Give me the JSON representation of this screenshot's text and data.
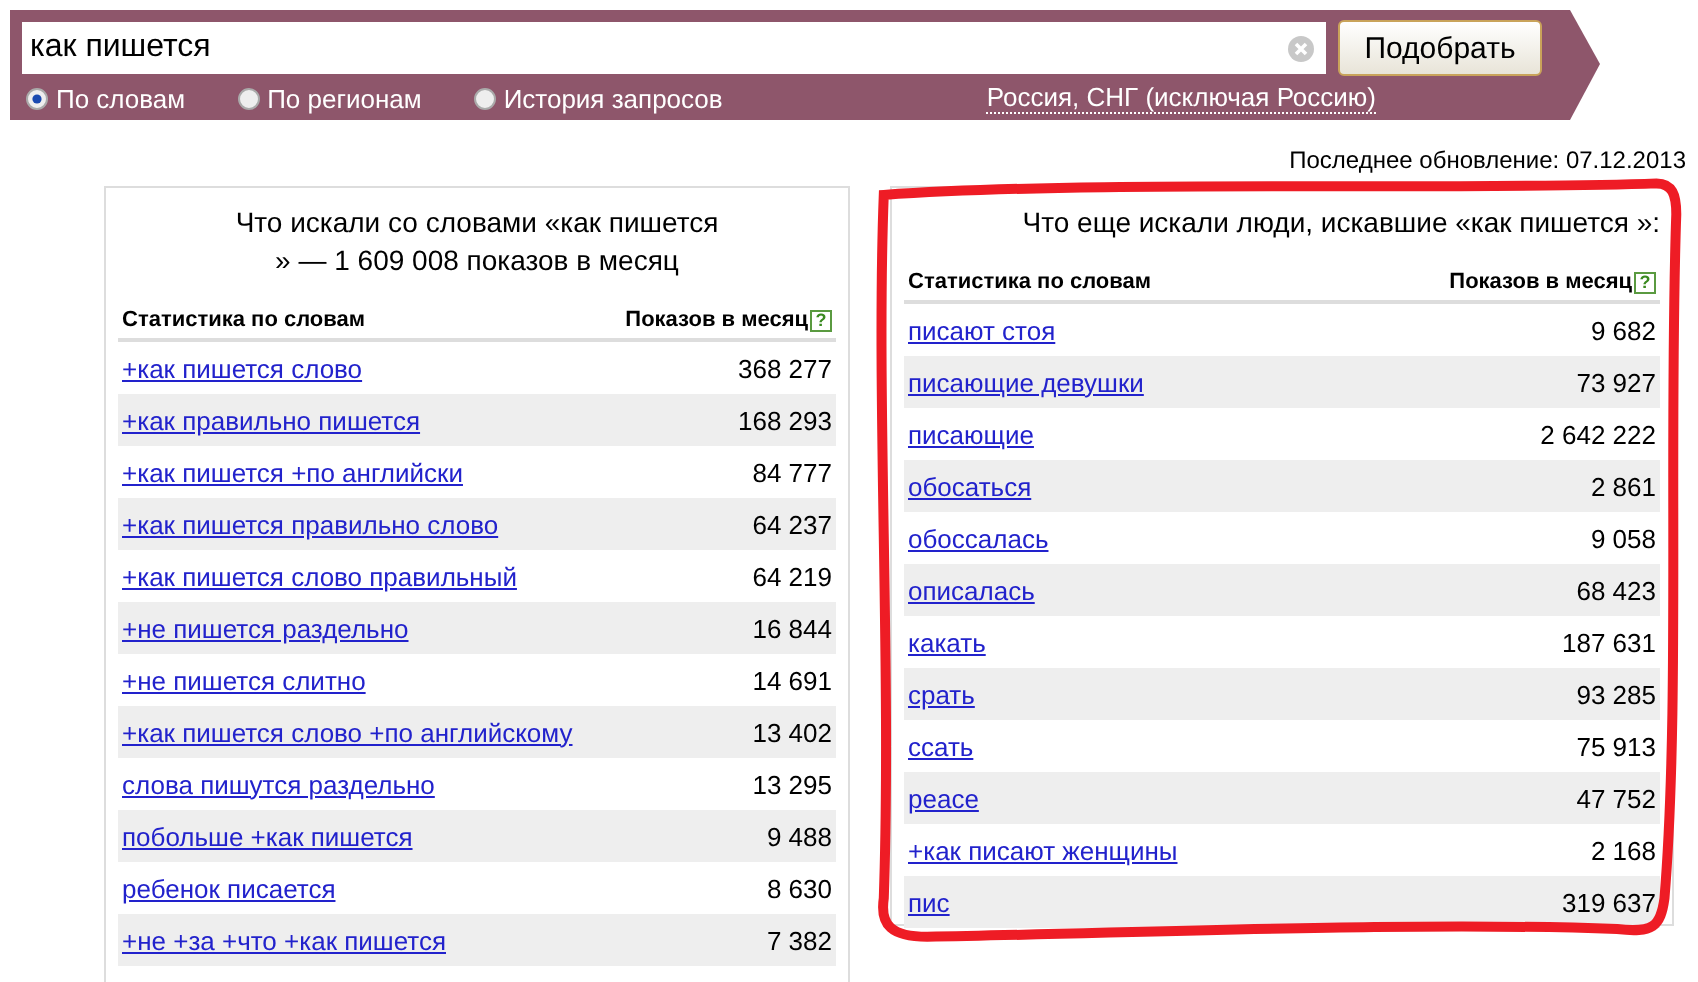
{
  "search": {
    "value": "как пишется",
    "button": "Подобрать"
  },
  "modes": [
    {
      "label": "По словам",
      "selected": true
    },
    {
      "label": "По регионам",
      "selected": false
    },
    {
      "label": "История запросов",
      "selected": false
    }
  ],
  "region_link": "Россия, СНГ (исключая Россию)",
  "last_update": "Последнее обновление: 07.12.2013",
  "panels": [
    {
      "title": "Что искали со словами «как пишется » — 1 609 008 показов в месяц",
      "highlighted": false,
      "columns": [
        {
          "label": "Статистика по словам"
        },
        {
          "label": "Показов в месяц",
          "help": "?"
        }
      ],
      "rows": [
        {
          "phrase": "+как пишется слово",
          "count": "368 277"
        },
        {
          "phrase": "+как правильно пишется",
          "count": "168 293"
        },
        {
          "phrase": "+как пишется +по английски",
          "count": "84 777"
        },
        {
          "phrase": "+как пишется правильно слово",
          "count": "64 237"
        },
        {
          "phrase": "+как пишется слово правильный",
          "count": "64 219"
        },
        {
          "phrase": "+не пишется раздельно",
          "count": "16 844"
        },
        {
          "phrase": "+не пишется слитно",
          "count": "14 691"
        },
        {
          "phrase": "+как пишется слово +по английскому",
          "count": "13 402"
        },
        {
          "phrase": "слова пишутся раздельно",
          "count": "13 295"
        },
        {
          "phrase": "побольше +как пишется",
          "count": "9 488"
        },
        {
          "phrase": "ребенок писается",
          "count": "8 630"
        },
        {
          "phrase": "+не +за +что +как пишется",
          "count": "7 382"
        }
      ]
    },
    {
      "title": "Что еще искали люди, искавшие «как пишется »:",
      "highlighted": true,
      "columns": [
        {
          "label": "Статистика по словам"
        },
        {
          "label": "Показов в месяц",
          "help": "?"
        }
      ],
      "rows": [
        {
          "phrase": "писают стоя",
          "count": "9 682"
        },
        {
          "phrase": "писающие девушки",
          "count": "73 927"
        },
        {
          "phrase": "писающие",
          "count": "2 642 222"
        },
        {
          "phrase": "обосаться",
          "count": "2 861"
        },
        {
          "phrase": "обоссалась",
          "count": "9 058"
        },
        {
          "phrase": "описалась",
          "count": "68 423"
        },
        {
          "phrase": "какать",
          "count": "187 631"
        },
        {
          "phrase": "срать",
          "count": "93 285"
        },
        {
          "phrase": "ссать",
          "count": "75 913"
        },
        {
          "phrase": "реасе",
          "count": "47 752"
        },
        {
          "phrase": "+как писают женщины",
          "count": "2 168"
        },
        {
          "phrase": "пис",
          "count": "319 637"
        }
      ]
    }
  ]
}
